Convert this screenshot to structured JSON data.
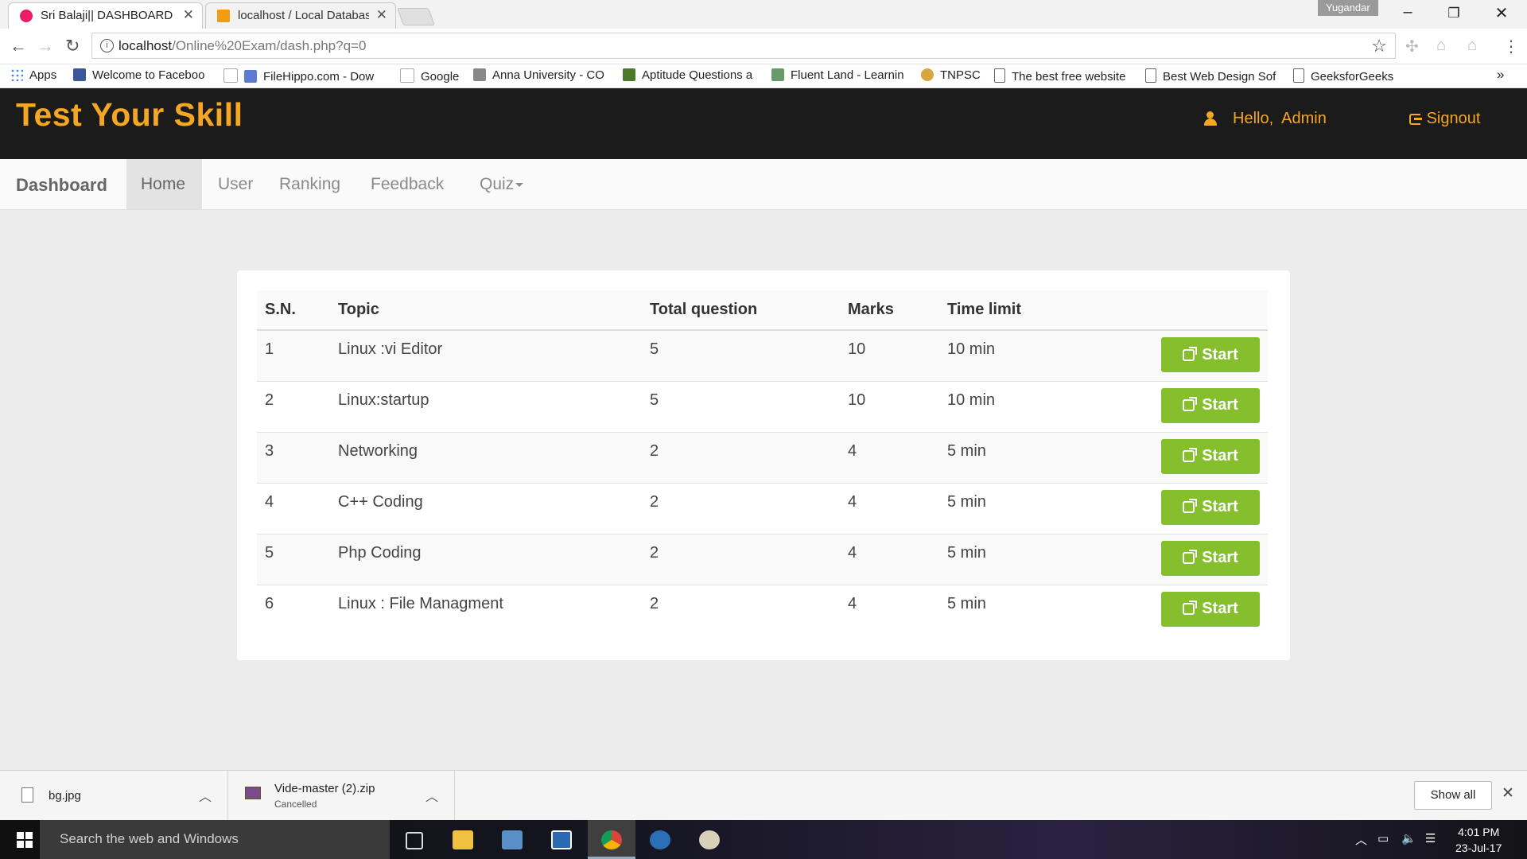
{
  "browser": {
    "tabs": [
      {
        "title": "Sri Balaji|| DASHBOARD",
        "active": true
      },
      {
        "title": "localhost / Local Databas",
        "active": false
      }
    ],
    "profile_name": "Yugandar",
    "url_host": "localhost",
    "url_path": "/Online%20Exam/dash.php?q=0",
    "bookmarks": [
      "Apps",
      "Welcome to Faceboo",
      "FileHippo.com - Dow",
      "Google",
      "Anna University - CO",
      "Aptitude Questions a",
      "Fluent Land - Learnin",
      "TNPSC",
      "The best free website",
      "Best Web Design Sof",
      "GeeksforGeeks"
    ],
    "bookmarks_overflow": "»"
  },
  "header": {
    "logo": "Test Your Skill",
    "hello": "Hello,",
    "user": "Admin",
    "signout": "Signout"
  },
  "nav": {
    "brand": "Dashboard",
    "items": [
      "Home",
      "User",
      "Ranking",
      "Feedback",
      "Quiz"
    ],
    "active": "Home"
  },
  "table": {
    "columns": [
      "S.N.",
      "Topic",
      "Total question",
      "Marks",
      "Time limit"
    ],
    "start_label": "Start",
    "rows": [
      {
        "sn": "1",
        "topic": "Linux :vi Editor",
        "total": "5",
        "marks": "10",
        "time": "10 min"
      },
      {
        "sn": "2",
        "topic": "Linux:startup",
        "total": "5",
        "marks": "10",
        "time": "10 min"
      },
      {
        "sn": "3",
        "topic": "Networking",
        "total": "2",
        "marks": "4",
        "time": "5 min"
      },
      {
        "sn": "4",
        "topic": "C++ Coding",
        "total": "2",
        "marks": "4",
        "time": "5 min"
      },
      {
        "sn": "5",
        "topic": "Php Coding",
        "total": "2",
        "marks": "4",
        "time": "5 min"
      },
      {
        "sn": "6",
        "topic": "Linux : File Managment",
        "total": "2",
        "marks": "4",
        "time": "5 min"
      }
    ]
  },
  "downloads": {
    "items": [
      {
        "name": "bg.jpg",
        "status": ""
      },
      {
        "name": "Vide-master (2).zip",
        "status": "Cancelled"
      }
    ],
    "show_all": "Show all"
  },
  "taskbar": {
    "search_placeholder": "Search the web and Windows",
    "time": "4:01 PM",
    "date": "23-Jul-17"
  },
  "colors": {
    "accent": "#f5a623",
    "header_bg": "#1b1b1b",
    "start_button": "#86bf2d"
  }
}
